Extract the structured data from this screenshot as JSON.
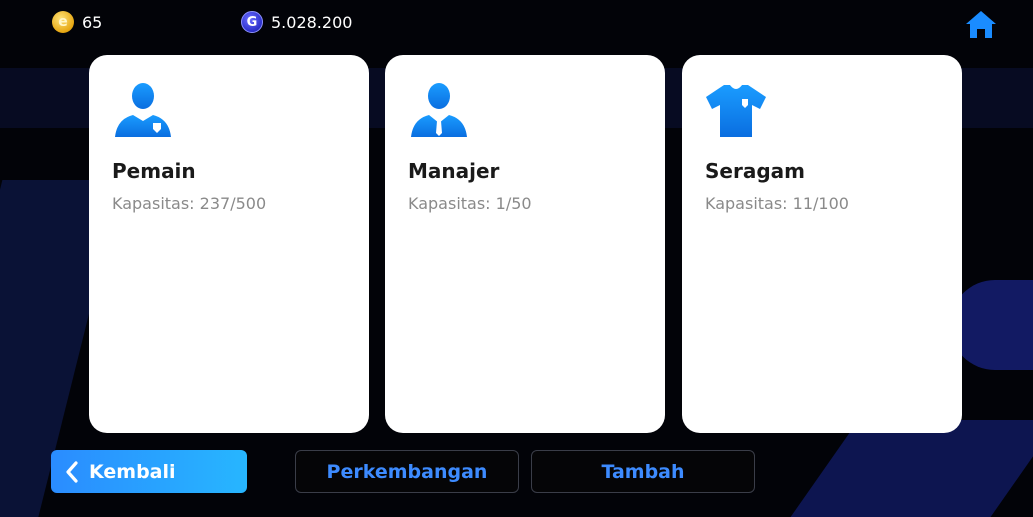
{
  "topbar": {
    "coins": {
      "icon": "coin-icon",
      "value": "65",
      "color": "#e6a712"
    },
    "gp": {
      "icon": "gp-icon",
      "icon_letter": "G",
      "value": "5.028.200",
      "color": "#2b2fc9"
    },
    "home": {
      "icon": "home-icon",
      "color": "#1a8cff"
    }
  },
  "cards": [
    {
      "icon": "player-icon",
      "title": "Pemain",
      "capacity": "Kapasitas: 237/500"
    },
    {
      "icon": "manager-icon",
      "title": "Manajer",
      "capacity": "Kapasitas: 1/50"
    },
    {
      "icon": "kit-icon",
      "title": "Seragam",
      "capacity": "Kapasitas: 11/100"
    }
  ],
  "buttons": {
    "back": {
      "icon": "chevron-left-icon",
      "label": "Kembali"
    },
    "develop": {
      "label": "Perkembangan"
    },
    "add": {
      "label": "Tambah"
    }
  },
  "colors": {
    "accent": "#2a8cff",
    "icon_blue": "#1a8cff",
    "outline_text": "#3d8bff"
  }
}
